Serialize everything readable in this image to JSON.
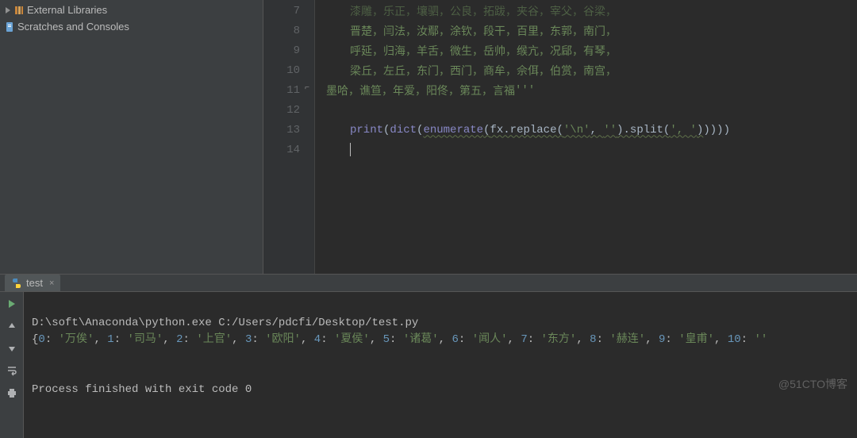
{
  "sidebar": {
    "items": [
      {
        "label": "External Libraries"
      },
      {
        "label": "Scratches and Consoles"
      }
    ]
  },
  "editor": {
    "lines": [
      {
        "n": 7,
        "indent": true,
        "type": "cn-cut",
        "text": "漆雕，乐正，壤驷，公良，拓跋，夹谷，宰父，谷梁，"
      },
      {
        "n": 8,
        "indent": true,
        "type": "cn",
        "text": "晋楚，闫法，汝鄢，涂钦，段干，百里，东郭，南门，"
      },
      {
        "n": 9,
        "indent": true,
        "type": "cn",
        "text": "呼延，归海，羊舌，微生，岳帅，缑亢，况郈，有琴，"
      },
      {
        "n": 10,
        "indent": true,
        "type": "cn",
        "text": "梁丘，左丘，东门，西门，商牟，佘佴，伯赏，南宫，"
      },
      {
        "n": 11,
        "indent": false,
        "fold": true,
        "type": "cn-end",
        "text": "墨哈，谯笪，年爱，阳佟，第五，言福",
        "tail": "'''"
      },
      {
        "n": 12,
        "indent": false,
        "type": "empty",
        "text": ""
      },
      {
        "n": 13,
        "indent": true,
        "type": "code"
      },
      {
        "n": 14,
        "indent": true,
        "type": "caret"
      }
    ],
    "code13": {
      "print": "print",
      "dict": "dict",
      "enumerate": "enumerate",
      "fx_replace": "fx.replace(",
      "s1": "'\\n'",
      "s2": ", ",
      "s3": "''",
      "split": ").split(",
      "s4": "', '",
      "tail": "))))"
    }
  },
  "run": {
    "tab_label": "test",
    "cmd": "D:\\soft\\Anaconda\\python.exe C:/Users/pdcfi/Desktop/test.py",
    "out_prefix": "{",
    "out_items": [
      {
        "k": "0",
        "v": "万俟"
      },
      {
        "k": "1",
        "v": "司马"
      },
      {
        "k": "2",
        "v": "上官"
      },
      {
        "k": "3",
        "v": "欧阳"
      },
      {
        "k": "4",
        "v": "夏侯"
      },
      {
        "k": "5",
        "v": "诸葛"
      },
      {
        "k": "6",
        "v": "闻人"
      },
      {
        "k": "7",
        "v": "东方"
      },
      {
        "k": "8",
        "v": "赫连"
      },
      {
        "k": "9",
        "v": "皇甫"
      },
      {
        "k": "10",
        "v": ""
      }
    ],
    "exit": "Process finished with exit code 0"
  },
  "watermark": "@51CTO博客"
}
